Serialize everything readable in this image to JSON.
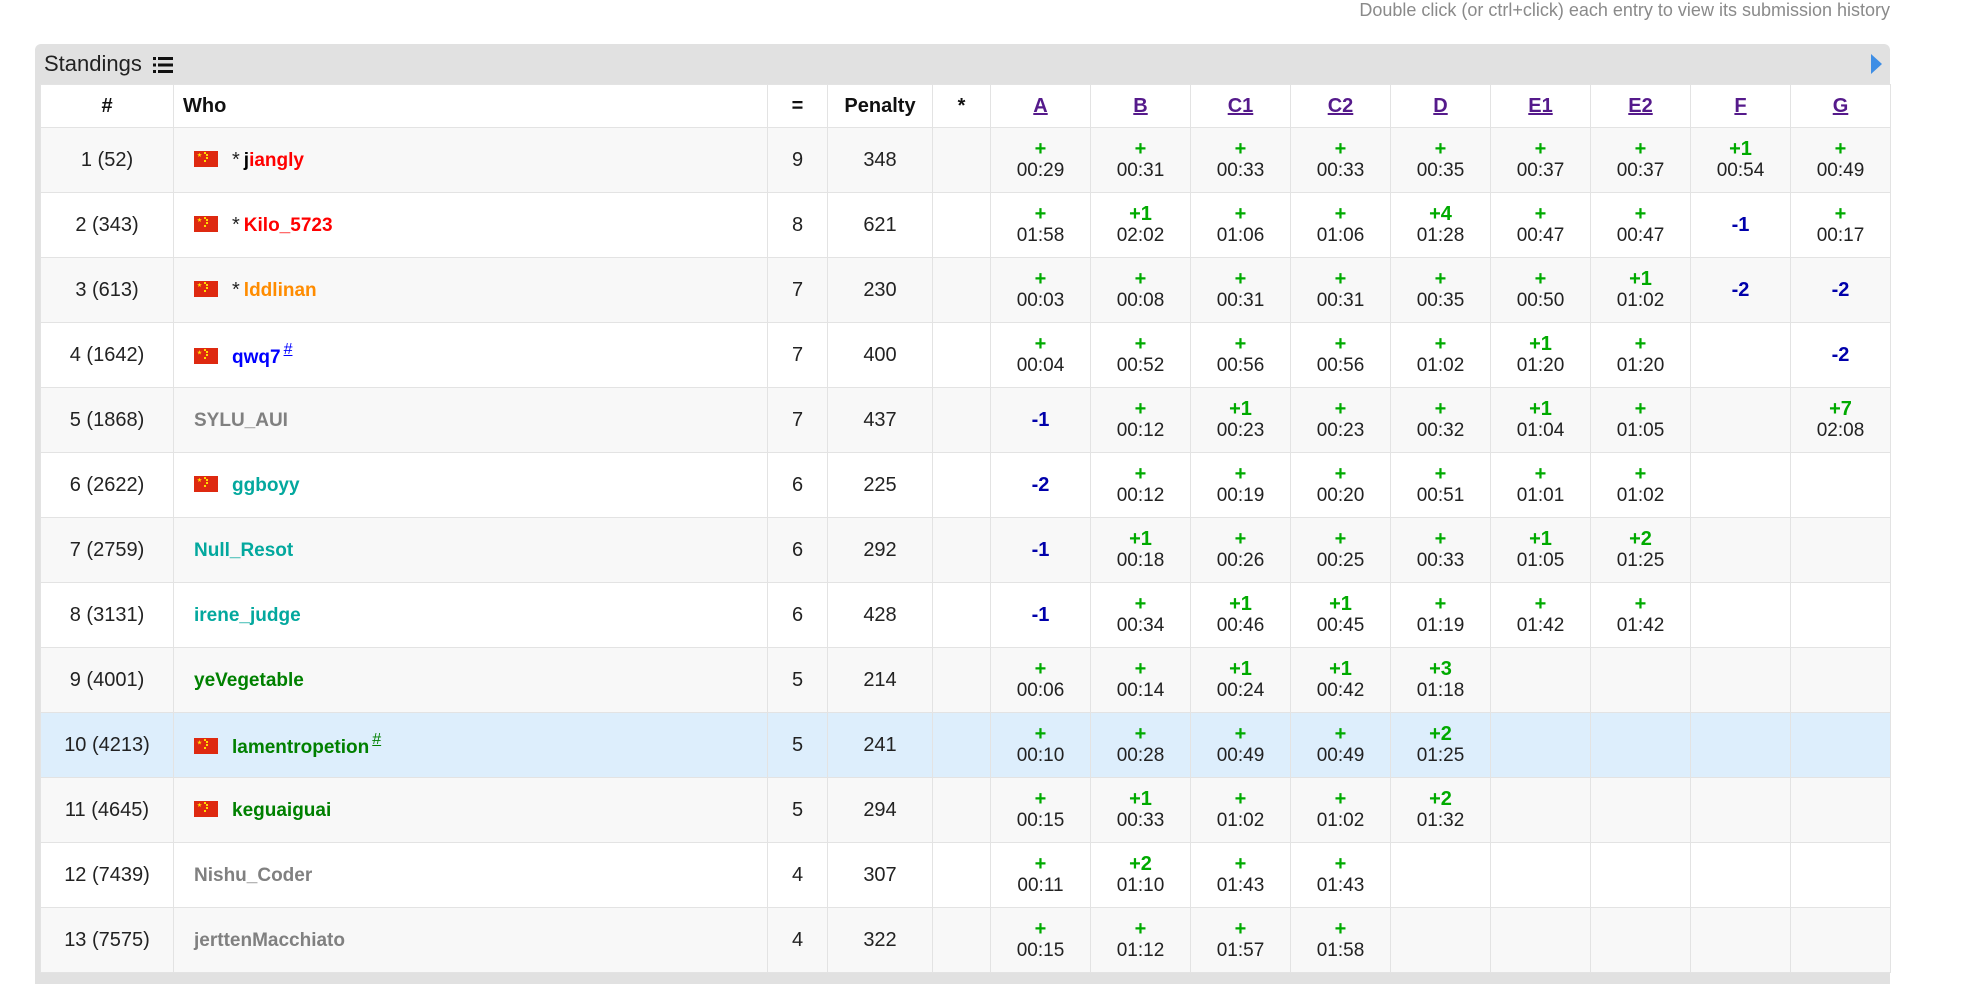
{
  "hint": "Double click (or ctrl+click) each entry to view its submission history",
  "panel": {
    "title": "Standings"
  },
  "colors": {
    "accepted": "#00aa00",
    "rejected": "#0000aa",
    "link": "#551a8b"
  },
  "icons": {
    "list": "list-icon",
    "expand": "triangle-right-icon",
    "flag": "china-flag-icon"
  },
  "columns": {
    "rank": "#",
    "who": "Who",
    "solved": "=",
    "penalty": "Penalty",
    "hacks": "*",
    "problems": [
      "A",
      "B",
      "C1",
      "C2",
      "D",
      "E1",
      "E2",
      "F",
      "G"
    ]
  },
  "rows": [
    {
      "rank": "1 (52)",
      "flag": true,
      "star": true,
      "name_hl": "j",
      "name": "iangly",
      "color": "#ff0000",
      "hash": false,
      "solved": "9",
      "penalty": "348",
      "cells": [
        [
          "+",
          "00:29"
        ],
        [
          "+",
          "00:31"
        ],
        [
          "+",
          "00:33"
        ],
        [
          "+",
          "00:33"
        ],
        [
          "+",
          "00:35"
        ],
        [
          "+",
          "00:37"
        ],
        [
          "+",
          "00:37"
        ],
        [
          "+1",
          "00:54"
        ],
        [
          "+",
          "00:49"
        ]
      ]
    },
    {
      "rank": "2 (343)",
      "flag": true,
      "star": true,
      "name_hl": "",
      "name": "Kilo_5723",
      "color": "#ff0000",
      "hash": false,
      "solved": "8",
      "penalty": "621",
      "cells": [
        [
          "+",
          "01:58"
        ],
        [
          "+1",
          "02:02"
        ],
        [
          "+",
          "01:06"
        ],
        [
          "+",
          "01:06"
        ],
        [
          "+4",
          "01:28"
        ],
        [
          "+",
          "00:47"
        ],
        [
          "+",
          "00:47"
        ],
        [
          "-1",
          ""
        ],
        [
          "+",
          "00:17"
        ]
      ]
    },
    {
      "rank": "3 (613)",
      "flag": true,
      "star": true,
      "name_hl": "",
      "name": "lddlinan",
      "color": "#ff8c00",
      "hash": false,
      "solved": "7",
      "penalty": "230",
      "cells": [
        [
          "+",
          "00:03"
        ],
        [
          "+",
          "00:08"
        ],
        [
          "+",
          "00:31"
        ],
        [
          "+",
          "00:31"
        ],
        [
          "+",
          "00:35"
        ],
        [
          "+",
          "00:50"
        ],
        [
          "+1",
          "01:02"
        ],
        [
          "-2",
          ""
        ],
        [
          "-2",
          ""
        ]
      ]
    },
    {
      "rank": "4 (1642)",
      "flag": true,
      "star": false,
      "name_hl": "",
      "name": "qwq7",
      "color": "#0000ff",
      "hash": true,
      "solved": "7",
      "penalty": "400",
      "cells": [
        [
          "+",
          "00:04"
        ],
        [
          "+",
          "00:52"
        ],
        [
          "+",
          "00:56"
        ],
        [
          "+",
          "00:56"
        ],
        [
          "+",
          "01:02"
        ],
        [
          "+1",
          "01:20"
        ],
        [
          "+",
          "01:20"
        ],
        [
          "",
          ""
        ],
        [
          "-2",
          ""
        ]
      ]
    },
    {
      "rank": "5 (1868)",
      "flag": false,
      "star": false,
      "name_hl": "",
      "name": "SYLU_AUI",
      "color": "#808080",
      "hash": false,
      "solved": "7",
      "penalty": "437",
      "cells": [
        [
          "-1",
          ""
        ],
        [
          "+",
          "00:12"
        ],
        [
          "+1",
          "00:23"
        ],
        [
          "+",
          "00:23"
        ],
        [
          "+",
          "00:32"
        ],
        [
          "+1",
          "01:04"
        ],
        [
          "+",
          "01:05"
        ],
        [
          "",
          ""
        ],
        [
          "+7",
          "02:08"
        ]
      ]
    },
    {
      "rank": "6 (2622)",
      "flag": true,
      "star": false,
      "name_hl": "",
      "name": "ggboyy",
      "color": "#03a89e",
      "hash": false,
      "solved": "6",
      "penalty": "225",
      "cells": [
        [
          "-2",
          ""
        ],
        [
          "+",
          "00:12"
        ],
        [
          "+",
          "00:19"
        ],
        [
          "+",
          "00:20"
        ],
        [
          "+",
          "00:51"
        ],
        [
          "+",
          "01:01"
        ],
        [
          "+",
          "01:02"
        ],
        [
          "",
          ""
        ],
        [
          "",
          ""
        ]
      ]
    },
    {
      "rank": "7 (2759)",
      "flag": false,
      "star": false,
      "name_hl": "",
      "name": "Null_Resot",
      "color": "#03a89e",
      "hash": false,
      "solved": "6",
      "penalty": "292",
      "cells": [
        [
          "-1",
          ""
        ],
        [
          "+1",
          "00:18"
        ],
        [
          "+",
          "00:26"
        ],
        [
          "+",
          "00:25"
        ],
        [
          "+",
          "00:33"
        ],
        [
          "+1",
          "01:05"
        ],
        [
          "+2",
          "01:25"
        ],
        [
          "",
          ""
        ],
        [
          "",
          ""
        ]
      ]
    },
    {
      "rank": "8 (3131)",
      "flag": false,
      "star": false,
      "name_hl": "",
      "name": "irene_judge",
      "color": "#03a89e",
      "hash": false,
      "solved": "6",
      "penalty": "428",
      "cells": [
        [
          "-1",
          ""
        ],
        [
          "+",
          "00:34"
        ],
        [
          "+1",
          "00:46"
        ],
        [
          "+1",
          "00:45"
        ],
        [
          "+",
          "01:19"
        ],
        [
          "+",
          "01:42"
        ],
        [
          "+",
          "01:42"
        ],
        [
          "",
          ""
        ],
        [
          "",
          ""
        ]
      ]
    },
    {
      "rank": "9 (4001)",
      "flag": false,
      "star": false,
      "name_hl": "",
      "name": "yeVegetable",
      "color": "#008000",
      "hash": false,
      "solved": "5",
      "penalty": "214",
      "cells": [
        [
          "+",
          "00:06"
        ],
        [
          "+",
          "00:14"
        ],
        [
          "+1",
          "00:24"
        ],
        [
          "+1",
          "00:42"
        ],
        [
          "+3",
          "01:18"
        ],
        [
          "",
          ""
        ],
        [
          "",
          ""
        ],
        [
          "",
          ""
        ],
        [
          "",
          ""
        ]
      ]
    },
    {
      "rank": "10 (4213)",
      "flag": true,
      "star": false,
      "name_hl": "",
      "name": "lamentropetion",
      "color": "#008000",
      "hash": true,
      "solved": "5",
      "penalty": "241",
      "cells": [
        [
          "+",
          "00:10"
        ],
        [
          "+",
          "00:28"
        ],
        [
          "+",
          "00:49"
        ],
        [
          "+",
          "00:49"
        ],
        [
          "+2",
          "01:25"
        ],
        [
          "",
          ""
        ],
        [
          "",
          ""
        ],
        [
          "",
          ""
        ],
        [
          "",
          ""
        ]
      ]
    },
    {
      "rank": "11 (4645)",
      "flag": true,
      "star": false,
      "name_hl": "",
      "name": "keguaiguai",
      "color": "#008000",
      "hash": false,
      "solved": "5",
      "penalty": "294",
      "cells": [
        [
          "+",
          "00:15"
        ],
        [
          "+1",
          "00:33"
        ],
        [
          "+",
          "01:02"
        ],
        [
          "+",
          "01:02"
        ],
        [
          "+2",
          "01:32"
        ],
        [
          "",
          ""
        ],
        [
          "",
          ""
        ],
        [
          "",
          ""
        ],
        [
          "",
          ""
        ]
      ]
    },
    {
      "rank": "12 (7439)",
      "flag": false,
      "star": false,
      "name_hl": "",
      "name": "Nishu_Coder",
      "color": "#808080",
      "hash": false,
      "solved": "4",
      "penalty": "307",
      "cells": [
        [
          "+",
          "00:11"
        ],
        [
          "+2",
          "01:10"
        ],
        [
          "+",
          "01:43"
        ],
        [
          "+",
          "01:43"
        ],
        [
          "",
          ""
        ],
        [
          "",
          ""
        ],
        [
          "",
          ""
        ],
        [
          "",
          ""
        ],
        [
          "",
          ""
        ]
      ]
    },
    {
      "rank": "13 (7575)",
      "flag": false,
      "star": false,
      "name_hl": "",
      "name": "jerttenMacchiato",
      "color": "#808080",
      "hash": false,
      "solved": "4",
      "penalty": "322",
      "cells": [
        [
          "+",
          "00:15"
        ],
        [
          "+",
          "01:12"
        ],
        [
          "+",
          "01:57"
        ],
        [
          "+",
          "01:58"
        ],
        [
          "",
          ""
        ],
        [
          "",
          ""
        ],
        [
          "",
          ""
        ],
        [
          "",
          ""
        ],
        [
          "",
          ""
        ]
      ]
    }
  ],
  "highlight_row": 9,
  "hash_label": "#",
  "star_label": "*"
}
